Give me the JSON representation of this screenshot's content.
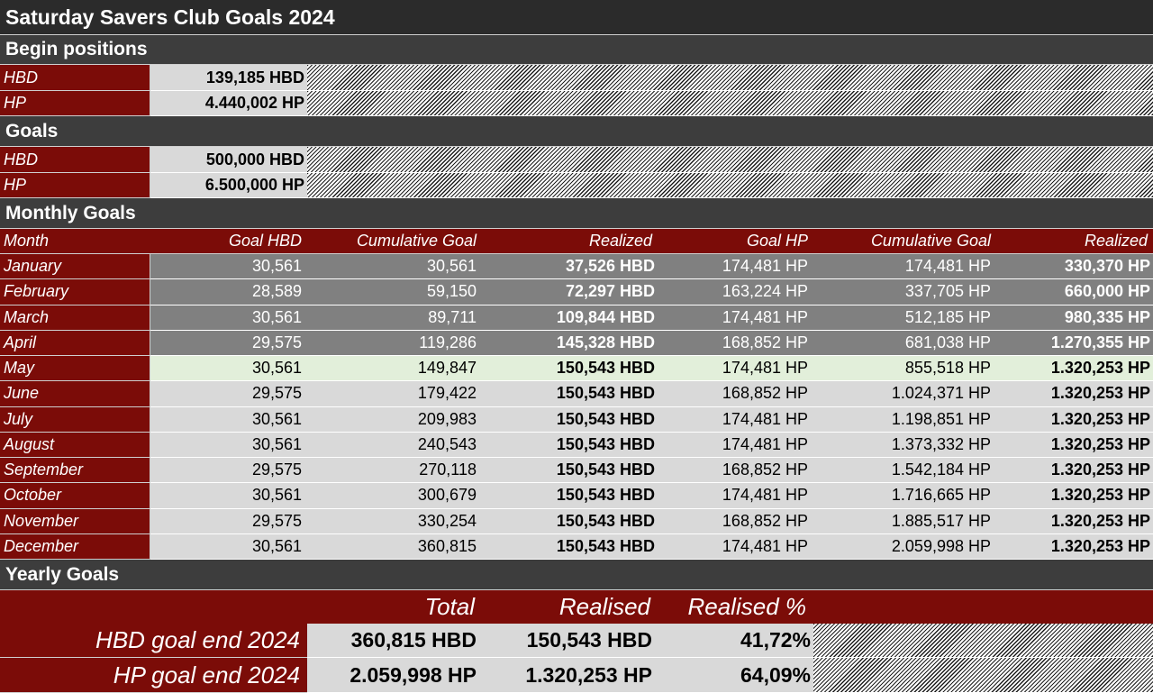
{
  "title": "Saturday Savers Club Goals 2024",
  "begin_positions": {
    "heading": "Begin positions",
    "rows": [
      {
        "label": "HBD",
        "value": "139,185 HBD"
      },
      {
        "label": "HP",
        "value": "4.440,002 HP"
      }
    ]
  },
  "goals": {
    "heading": "Goals",
    "rows": [
      {
        "label": "HBD",
        "value": "500,000 HBD"
      },
      {
        "label": "HP",
        "value": "6.500,000 HP"
      }
    ]
  },
  "monthly": {
    "heading": "Monthly Goals",
    "columns": [
      "Month",
      "Goal HBD",
      "Cumulative Goal",
      "Realized",
      "Goal HP",
      "Cumulative Goal",
      "Realized"
    ],
    "rows": [
      {
        "month": "January",
        "goal_hbd": "30,561",
        "cum_hbd": "30,561",
        "realized_hbd": "37,526 HBD",
        "goal_hp": "174,481 HP",
        "cum_hp": "174,481 HP",
        "realized_hp": "330,370 HP",
        "state": "past"
      },
      {
        "month": "February",
        "goal_hbd": "28,589",
        "cum_hbd": "59,150",
        "realized_hbd": "72,297 HBD",
        "goal_hp": "163,224 HP",
        "cum_hp": "337,705 HP",
        "realized_hp": "660,000 HP",
        "state": "past"
      },
      {
        "month": "March",
        "goal_hbd": "30,561",
        "cum_hbd": "89,711",
        "realized_hbd": "109,844 HBD",
        "goal_hp": "174,481 HP",
        "cum_hp": "512,185 HP",
        "realized_hp": "980,335 HP",
        "state": "past"
      },
      {
        "month": "April",
        "goal_hbd": "29,575",
        "cum_hbd": "119,286",
        "realized_hbd": "145,328 HBD",
        "goal_hp": "168,852 HP",
        "cum_hp": "681,038 HP",
        "realized_hp": "1.270,355 HP",
        "state": "past"
      },
      {
        "month": "May",
        "goal_hbd": "30,561",
        "cum_hbd": "149,847",
        "realized_hbd": "150,543 HBD",
        "goal_hp": "174,481 HP",
        "cum_hp": "855,518 HP",
        "realized_hp": "1.320,253 HP",
        "state": "current"
      },
      {
        "month": "June",
        "goal_hbd": "29,575",
        "cum_hbd": "179,422",
        "realized_hbd": "150,543 HBD",
        "goal_hp": "168,852 HP",
        "cum_hp": "1.024,371 HP",
        "realized_hp": "1.320,253 HP",
        "state": "future"
      },
      {
        "month": "July",
        "goal_hbd": "30,561",
        "cum_hbd": "209,983",
        "realized_hbd": "150,543 HBD",
        "goal_hp": "174,481 HP",
        "cum_hp": "1.198,851 HP",
        "realized_hp": "1.320,253 HP",
        "state": "future"
      },
      {
        "month": "August",
        "goal_hbd": "30,561",
        "cum_hbd": "240,543",
        "realized_hbd": "150,543 HBD",
        "goal_hp": "174,481 HP",
        "cum_hp": "1.373,332 HP",
        "realized_hp": "1.320,253 HP",
        "state": "future"
      },
      {
        "month": "September",
        "goal_hbd": "29,575",
        "cum_hbd": "270,118",
        "realized_hbd": "150,543 HBD",
        "goal_hp": "168,852 HP",
        "cum_hp": "1.542,184 HP",
        "realized_hp": "1.320,253 HP",
        "state": "future"
      },
      {
        "month": "October",
        "goal_hbd": "30,561",
        "cum_hbd": "300,679",
        "realized_hbd": "150,543 HBD",
        "goal_hp": "174,481 HP",
        "cum_hp": "1.716,665 HP",
        "realized_hp": "1.320,253 HP",
        "state": "future"
      },
      {
        "month": "November",
        "goal_hbd": "29,575",
        "cum_hbd": "330,254",
        "realized_hbd": "150,543 HBD",
        "goal_hp": "168,852 HP",
        "cum_hp": "1.885,517 HP",
        "realized_hp": "1.320,253 HP",
        "state": "future"
      },
      {
        "month": "December",
        "goal_hbd": "30,561",
        "cum_hbd": "360,815",
        "realized_hbd": "150,543 HBD",
        "goal_hp": "174,481 HP",
        "cum_hp": "2.059,998 HP",
        "realized_hp": "1.320,253 HP",
        "state": "future"
      }
    ]
  },
  "yearly": {
    "heading": "Yearly Goals",
    "columns": [
      "Total",
      "Realised",
      "Realised %"
    ],
    "rows": [
      {
        "label": "HBD goal end 2024",
        "total": "360,815 HBD",
        "realised": "150,543 HBD",
        "pct": "41,72%"
      },
      {
        "label": "HP goal end 2024",
        "total": "2.059,998 HP",
        "realised": "1.320,253 HP",
        "pct": "64,09%"
      }
    ]
  },
  "colors": {
    "dark_red": "#7b0c08",
    "title_bg": "#2b2b2b",
    "section_bg": "#3d3d3d",
    "past_row": "#808080",
    "current_row": "#e2efda",
    "future_row": "#d9d9d9"
  }
}
